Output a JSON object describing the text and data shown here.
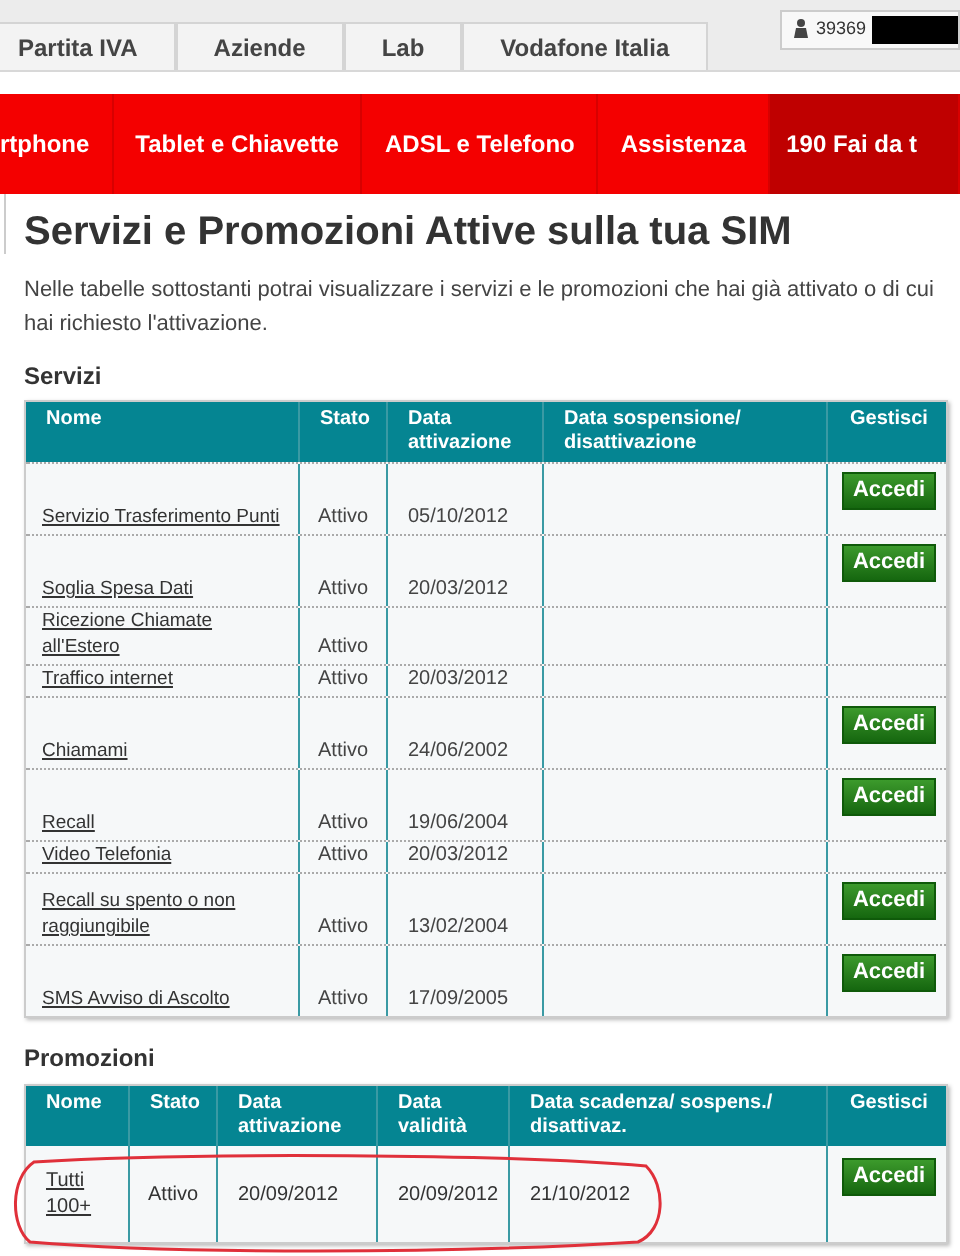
{
  "top_tabs": [
    {
      "label": "Partita IVA"
    },
    {
      "label": "Aziende"
    },
    {
      "label": "Lab"
    },
    {
      "label": "Vodafone Italia"
    }
  ],
  "user": {
    "number": "39369"
  },
  "nav": [
    {
      "label": "rtphone",
      "selected": false
    },
    {
      "label": "Tablet e Chiavette",
      "selected": false
    },
    {
      "label": "ADSL e Telefono",
      "selected": false
    },
    {
      "label": "Assistenza",
      "selected": false
    },
    {
      "label": "190 Fai da t",
      "selected": true
    }
  ],
  "title": "Servizi e Promozioni Attive sulla tua SIM",
  "intro": "Nelle tabelle sottostanti potrai visualizzare i servizi e le promozioni che hai già attivato o di cui hai richiesto l'attivazione.",
  "services": {
    "heading": "Servizi",
    "columns": [
      "Nome",
      "Stato",
      "Data attivazione",
      "Data sospensione/ disattivazione",
      "Gestisci"
    ],
    "rows": [
      {
        "name": "Servizio Trasferimento Punti",
        "status": "Attivo",
        "activated": "05/10/2012",
        "action": "Accedi"
      },
      {
        "name": "Soglia Spesa Dati",
        "status": "Attivo",
        "activated": "20/03/2012",
        "action": "Accedi"
      },
      {
        "name": "Ricezione Chiamate all'Estero",
        "status": "Attivo"
      },
      {
        "name": "Traffico internet",
        "status": "Attivo",
        "activated": "20/03/2012"
      },
      {
        "name": "Chiamami",
        "status": "Attivo",
        "activated": "24/06/2002",
        "action": "Accedi"
      },
      {
        "name": "Recall",
        "status": "Attivo",
        "activated": "19/06/2004",
        "action": "Accedi"
      },
      {
        "name": "Video Telefonia",
        "status": "Attivo",
        "activated": "20/03/2012"
      },
      {
        "name": "Recall su spento o non raggiungibile",
        "status": "Attivo",
        "activated": "13/02/2004",
        "action": "Accedi"
      },
      {
        "name": "SMS Avviso di Ascolto",
        "status": "Attivo",
        "activated": "17/09/2005",
        "action": "Accedi"
      }
    ]
  },
  "promotions": {
    "heading": "Promozioni",
    "columns": [
      "Nome",
      "Stato",
      "Data attivazione",
      "Data validità",
      "Data scadenza/ sospens./ disattivaz.",
      "Gestisci"
    ],
    "rows": [
      {
        "name": "Tutti 100+",
        "status": "Attivo",
        "activated": "20/09/2012",
        "valid": "20/09/2012",
        "expires": "21/10/2012",
        "action": "Accedi",
        "circled": true
      }
    ]
  }
}
